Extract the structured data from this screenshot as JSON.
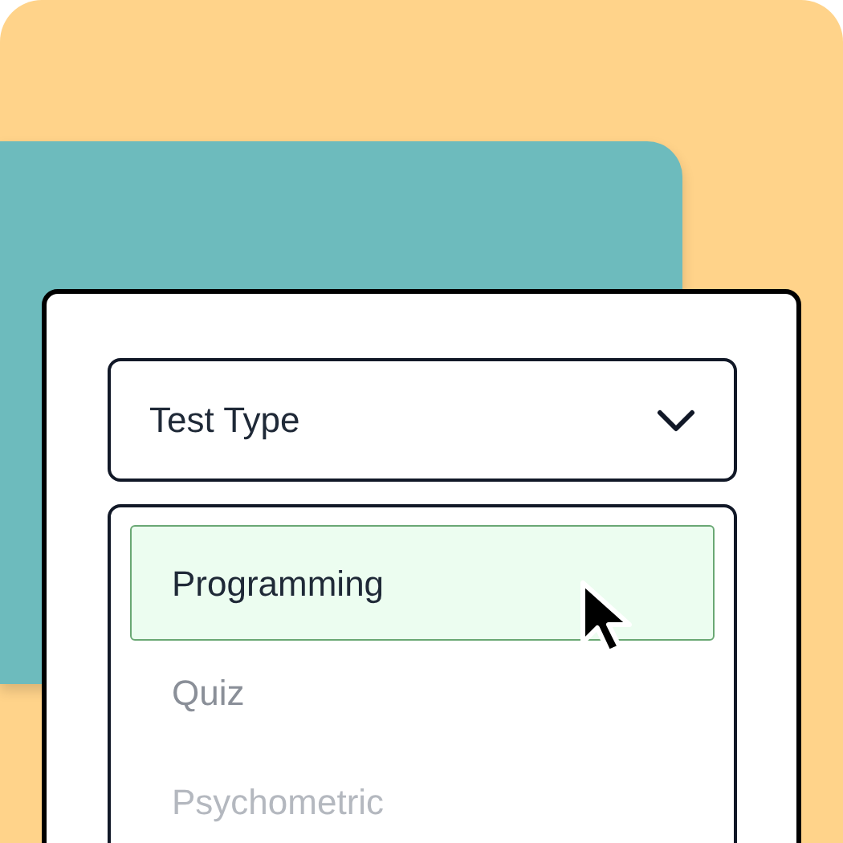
{
  "dropdown": {
    "label": "Test Type",
    "expanded": true
  },
  "options": [
    {
      "label": "Programming",
      "selected": true,
      "faded": false
    },
    {
      "label": "Quiz",
      "selected": false,
      "faded": false
    },
    {
      "label": "Psychometric",
      "selected": false,
      "faded": true
    }
  ]
}
